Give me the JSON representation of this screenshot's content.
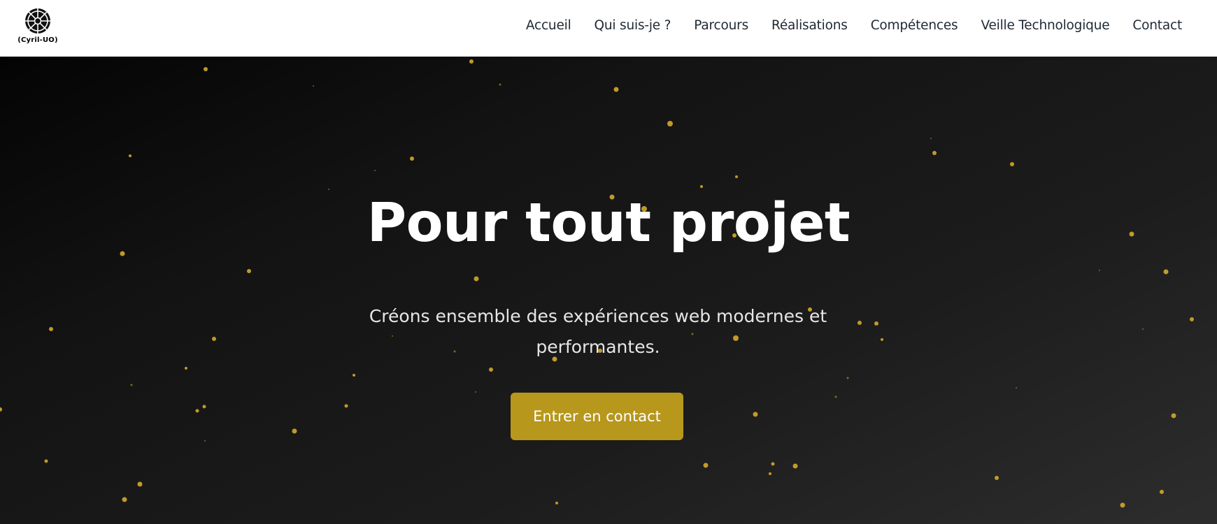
{
  "header": {
    "logo_text": "(Cyril-UO)",
    "nav": {
      "home": "Accueil",
      "about": "Qui suis-je ?",
      "path": "Parcours",
      "projects": "Réalisations",
      "skills": "Compétences",
      "watch": "Veille Technologique",
      "contact": "Contact"
    }
  },
  "hero": {
    "title": "Pour tout projet",
    "subtitle": "Créons ensemble des expériences web modernes et performantes.",
    "cta_label": "Entrer en contact"
  },
  "colors": {
    "accent": "#b7971c",
    "particle": "#d4a82a",
    "hero_background_dark": "#040404",
    "hero_background_light": "#2d2d2d"
  },
  "icons": {
    "logo": "wheel-logo-icon"
  }
}
